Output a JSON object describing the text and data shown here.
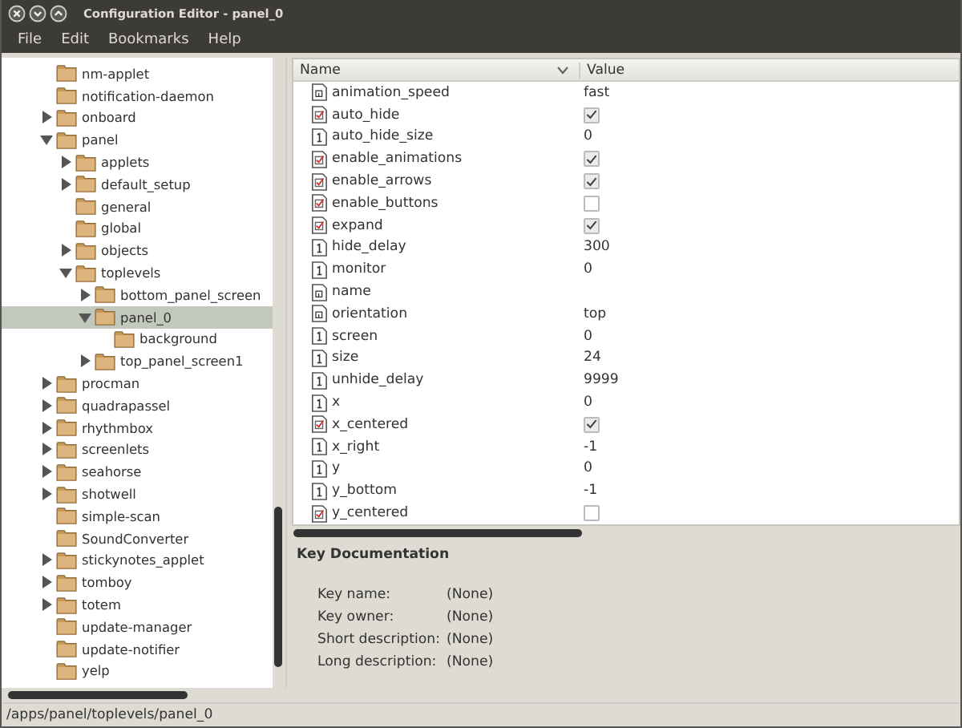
{
  "window": {
    "title": "Configuration Editor - panel_0"
  },
  "menu": [
    "File",
    "Edit",
    "Bookmarks",
    "Help"
  ],
  "tree": [
    {
      "label": "nm-applet",
      "selected": false
    },
    {
      "label": "notification-daemon",
      "selected": false
    },
    {
      "label": "onboard",
      "expanded": false,
      "selected": false
    },
    {
      "label": "panel",
      "expanded": true,
      "selected": false,
      "children": [
        {
          "label": "applets",
          "expanded": false,
          "selected": false
        },
        {
          "label": "default_setup",
          "expanded": false,
          "selected": false
        },
        {
          "label": "general",
          "selected": false
        },
        {
          "label": "global",
          "selected": false
        },
        {
          "label": "objects",
          "expanded": false,
          "selected": false
        },
        {
          "label": "toplevels",
          "expanded": true,
          "selected": false,
          "children": [
            {
              "label": "bottom_panel_screen",
              "expanded": false,
              "selected": false
            },
            {
              "label": "panel_0",
              "expanded": true,
              "selected": true,
              "children": [
                {
                  "label": "background",
                  "selected": false
                }
              ]
            },
            {
              "label": "top_panel_screen1",
              "expanded": false,
              "selected": false
            }
          ]
        }
      ]
    },
    {
      "label": "procman",
      "expanded": false,
      "selected": false
    },
    {
      "label": "quadrapassel",
      "expanded": false,
      "selected": false
    },
    {
      "label": "rhythmbox",
      "expanded": false,
      "selected": false
    },
    {
      "label": "screenlets",
      "expanded": false,
      "selected": false
    },
    {
      "label": "seahorse",
      "expanded": false,
      "selected": false
    },
    {
      "label": "shotwell",
      "expanded": false,
      "selected": false
    },
    {
      "label": "simple-scan",
      "selected": false
    },
    {
      "label": "SoundConverter",
      "selected": false
    },
    {
      "label": "stickynotes_applet",
      "expanded": false,
      "selected": false
    },
    {
      "label": "tomboy",
      "expanded": false,
      "selected": false
    },
    {
      "label": "totem",
      "expanded": false,
      "selected": false
    },
    {
      "label": "update-manager",
      "selected": false
    },
    {
      "label": "update-notifier",
      "selected": false
    },
    {
      "label": "yelp",
      "selected": false
    }
  ],
  "table": {
    "columns": [
      "Name",
      "Value"
    ],
    "rows": [
      {
        "name": "animation_speed",
        "kind": "string",
        "value": "fast"
      },
      {
        "name": "auto_hide",
        "kind": "bool",
        "checked": true
      },
      {
        "name": "auto_hide_size",
        "kind": "int",
        "value": "0"
      },
      {
        "name": "enable_animations",
        "kind": "bool",
        "checked": true
      },
      {
        "name": "enable_arrows",
        "kind": "bool",
        "checked": true
      },
      {
        "name": "enable_buttons",
        "kind": "bool",
        "checked": false
      },
      {
        "name": "expand",
        "kind": "bool",
        "checked": true
      },
      {
        "name": "hide_delay",
        "kind": "int",
        "value": "300"
      },
      {
        "name": "monitor",
        "kind": "int",
        "value": "0"
      },
      {
        "name": "name",
        "kind": "string"
      },
      {
        "name": "orientation",
        "kind": "string",
        "value": "top"
      },
      {
        "name": "screen",
        "kind": "int",
        "value": "0"
      },
      {
        "name": "size",
        "kind": "int",
        "value": "24"
      },
      {
        "name": "unhide_delay",
        "kind": "int",
        "value": "9999"
      },
      {
        "name": "x",
        "kind": "int",
        "value": "0"
      },
      {
        "name": "x_centered",
        "kind": "bool",
        "checked": true
      },
      {
        "name": "x_right",
        "kind": "int",
        "value": "-1"
      },
      {
        "name": "y",
        "kind": "int",
        "value": "0"
      },
      {
        "name": "y_bottom",
        "kind": "int",
        "value": "-1"
      },
      {
        "name": "y_centered",
        "kind": "bool",
        "checked": false
      }
    ]
  },
  "documentation": {
    "title": "Key Documentation",
    "fields": [
      {
        "label": "Key name:",
        "value": "(None)"
      },
      {
        "label": "Key owner:",
        "value": "(None)"
      },
      {
        "label": "Short description:",
        "value": "(None)"
      },
      {
        "label": "Long description:",
        "value": "(None)"
      }
    ]
  },
  "status_bar": "/apps/panel/toplevels/panel_0"
}
